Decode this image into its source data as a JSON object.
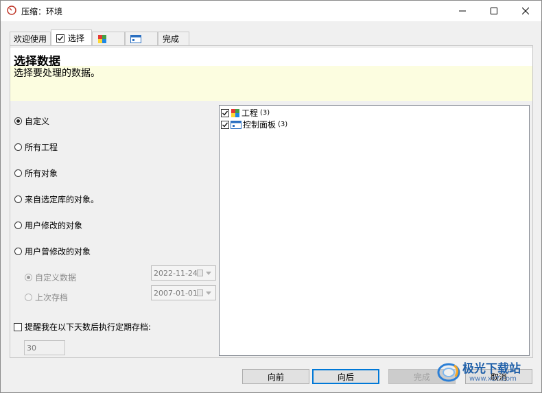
{
  "window": {
    "title": "压缩：环境"
  },
  "tabs": [
    {
      "label": "欢迎使用"
    },
    {
      "label": "选择",
      "checked": true
    },
    {
      "label": "",
      "icon": "project-icon"
    },
    {
      "label": "",
      "icon": "control-panel-icon"
    },
    {
      "label": "完成"
    }
  ],
  "header": {
    "title": "选择数据",
    "subtitle": "选择要处理的数据。"
  },
  "options": [
    {
      "label": "自定义",
      "selected": true
    },
    {
      "label": "所有工程",
      "selected": false
    },
    {
      "label": "所有对象",
      "selected": false
    },
    {
      "label": "来自选定库的对象。",
      "selected": false
    },
    {
      "label": "用户修改的对象",
      "selected": false
    },
    {
      "label": "用户曾修改的对象",
      "selected": false
    }
  ],
  "sub_options": [
    {
      "label": "自定义数据",
      "selected": true,
      "date": "2022-11-24"
    },
    {
      "label": "上次存档",
      "selected": false,
      "date": "2007-01-01"
    }
  ],
  "reminder": {
    "label": "提醒我在以下天数后执行定期存档:",
    "checked": false,
    "days": "30"
  },
  "tree": [
    {
      "label": "工程",
      "count": "(3)",
      "checked": true,
      "icon": "project-icon"
    },
    {
      "label": "控制面板",
      "count": "(3)",
      "checked": true,
      "icon": "control-panel-icon"
    }
  ],
  "buttons": {
    "back": "向前",
    "next": "向后",
    "finish": "完成",
    "cancel": "取消"
  },
  "watermark": {
    "text": "极光下载站",
    "url": "www.xz7.com"
  }
}
